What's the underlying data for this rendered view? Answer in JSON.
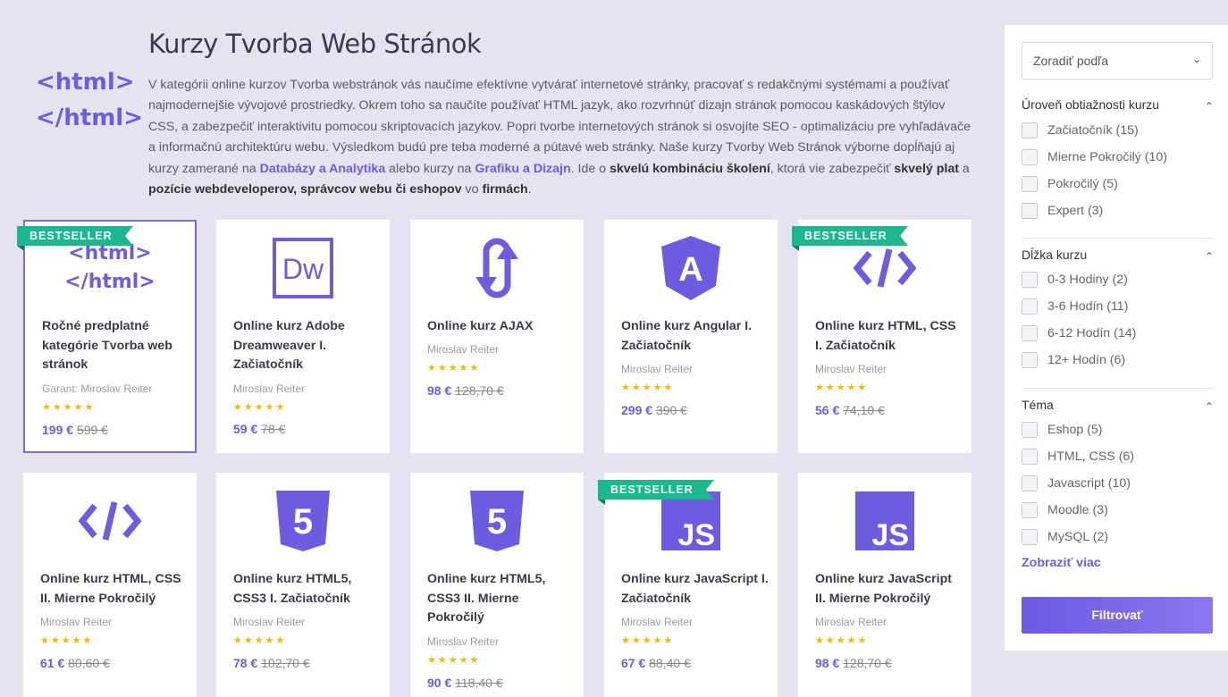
{
  "header": {
    "logo_line1": "<html>",
    "logo_line2": "</html>",
    "title": "Kurzy Tvorba Web Stránok",
    "desc_part1": "V kategórii online kurzov Tvorba webstránok vás naučíme efektívne vytvárať internetové stránky, pracovať s redakčnými systémami a používať najmodernejšie vývojové prostriedky. Okrem toho sa naučíte používať HTML jazyk, ako rozvrhnúť dizajn stránok pomocou kaskádových štýlov CSS, a zabezpečiť interaktivitu pomocou skriptovacích jazykov. Popri tvorbe internetových stránok si osvojíte SEO - optimalizáciu pre vyhľadávače a informačnú architektúru webu. Výsledkom budú pre teba moderné a pútavé web stránky. Naše kurzy Tvorby Web Stránok výborne dopĺňajú aj kurzy zamerané na ",
    "link1": "Databázy a Analytika",
    "desc_part2": " alebo kurzy na ",
    "link2": "Grafiku a Dizajn",
    "desc_part3": ". Ide o ",
    "bold1": "skvelú kombináciu školení",
    "desc_part4": ", ktorá vie zabezpečiť ",
    "bold2": "skvelý plat",
    "desc_part5": " a ",
    "bold3": "pozície webdeveloperov, správcov webu či eshopov",
    "desc_part6": " vo ",
    "bold4": "firmách",
    "desc_part7": "."
  },
  "badge_label": "BESTSELLER",
  "cards": [
    {
      "name": "Ročné predplatné kategórie Tvorba web stránok",
      "author": "Garant: Miroslav Reiter",
      "stars": "★★★★★",
      "rating": 4.5,
      "price": "199 €",
      "old_price": "599 €",
      "icon": "html-text-logo"
    },
    {
      "name": "Online kurz Adobe Dreamweaver I. Začiatočník",
      "author": "Miroslav Reiter",
      "stars": "★★★★★",
      "rating": 5,
      "price": "59 €",
      "old_price": "78 €",
      "icon": "dreamweaver-icon"
    },
    {
      "name": "Online kurz AJAX",
      "author": "Miroslav Reiter",
      "stars": "★★★★★",
      "rating": 4.5,
      "price": "98 €",
      "old_price": "128,70 €",
      "icon": "ajax-icon"
    },
    {
      "name": "Online kurz Angular I. Začiatočník",
      "author": "Miroslav Reiter",
      "stars": "★★★★★",
      "rating": 4.5,
      "price": "299 €",
      "old_price": "390 €",
      "icon": "angular-icon"
    },
    {
      "name": "Online kurz HTML, CSS I. Začiatočník",
      "author": "Miroslav Reiter",
      "stars": "★★★★★",
      "rating": 4.5,
      "price": "56 €",
      "old_price": "74,10 €",
      "icon": "code-icon"
    },
    {
      "name": "Online kurz HTML, CSS II. Mierne Pokročilý",
      "author": "Miroslav Reiter",
      "stars": "★★★★★",
      "rating": 4.5,
      "price": "61 €",
      "old_price": "80,60 €",
      "icon": "code-icon"
    },
    {
      "name": "Online kurz HTML5, CSS3 I. Začiatočník",
      "author": "Miroslav Reiter",
      "stars": "★★★★★",
      "rating": 5,
      "price": "78 €",
      "old_price": "102,70 €",
      "icon": "html5-icon"
    },
    {
      "name": "Online kurz HTML5, CSS3 II. Mierne Pokročilý",
      "author": "Miroslav Reiter",
      "stars": "★★★★★",
      "rating": 5,
      "price": "90 €",
      "old_price": "118,40 €",
      "icon": "html5-icon"
    },
    {
      "name": "Online kurz JavaScript I. Začiatočník",
      "author": "Miroslav Reiter",
      "stars": "★★★★★",
      "rating": 5,
      "price": "67 €",
      "old_price": "88,40 €",
      "icon": "js-icon"
    },
    {
      "name": "Online kurz JavaScript II. Mierne Pokročilý",
      "author": "Miroslav Reiter",
      "stars": "★★★★★",
      "rating": 5,
      "price": "98 €",
      "old_price": "128,70 €",
      "icon": "js-icon"
    }
  ],
  "sidebar": {
    "sort_label": "Zoradiť podľa",
    "sections": [
      {
        "title": "Úroveň obtiažnosti kurzu",
        "options": [
          "Začiatočník (15)",
          "Mierne Pokročilý (10)",
          "Pokročilý (5)",
          "Expert (3)"
        ]
      },
      {
        "title": "Dĺžka kurzu",
        "options": [
          "0-3 Hodiny (2)",
          "3-6 Hodín (11)",
          "6-12 Hodín (14)",
          "12+ Hodín (6)"
        ]
      },
      {
        "title": "Téma",
        "options": [
          "Eshop (5)",
          "HTML, CSS (6)",
          "Javascript (10)",
          "Moodle (3)",
          "MySQL (2)"
        ]
      }
    ],
    "more_label": "Zobraziť viac",
    "filter_label": "Filtrovať"
  },
  "colors": {
    "accent": "#6d5ce0",
    "badge": "#1cb78c",
    "star": "#f5b800"
  }
}
